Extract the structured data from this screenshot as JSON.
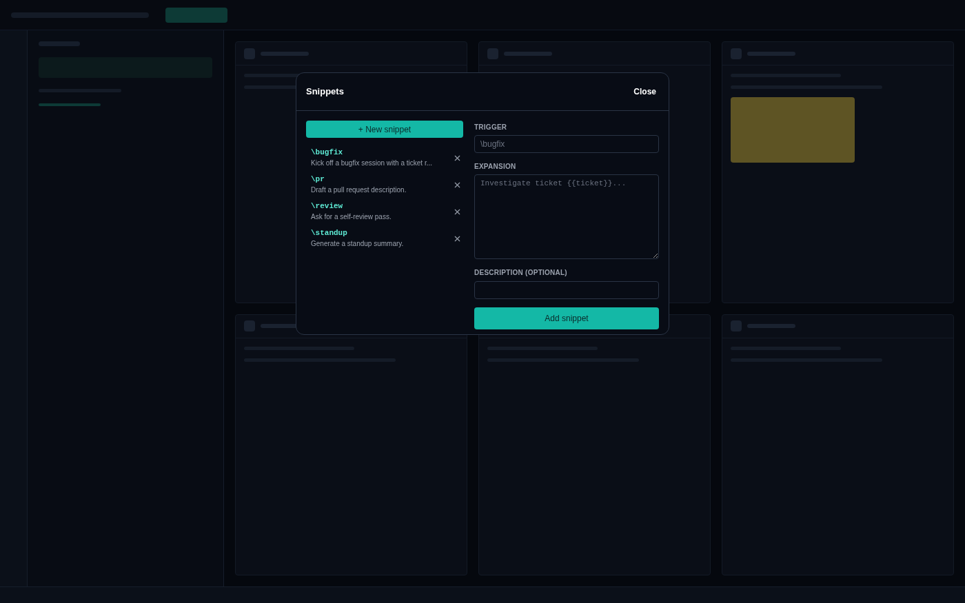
{
  "dialog": {
    "title": "Snippets",
    "close": "Close",
    "new_button": "+ New snippet",
    "snippets": [
      {
        "trigger": "\\bugfix",
        "description": "Kick off a bugfix session with a ticket r..."
      },
      {
        "trigger": "\\pr",
        "description": "Draft a pull request description."
      },
      {
        "trigger": "\\review",
        "description": "Ask for a self-review pass."
      },
      {
        "trigger": "\\standup",
        "description": "Generate a standup summary."
      }
    ],
    "trigger_label": "TRIGGER",
    "trigger_placeholder": "\\bugfix",
    "expansion_label": "EXPANSION",
    "expansion_placeholder": "Investigate ticket {{ticket}}...",
    "description_label": "DESCRIPTION (OPTIONAL)",
    "submit": "Add snippet"
  }
}
